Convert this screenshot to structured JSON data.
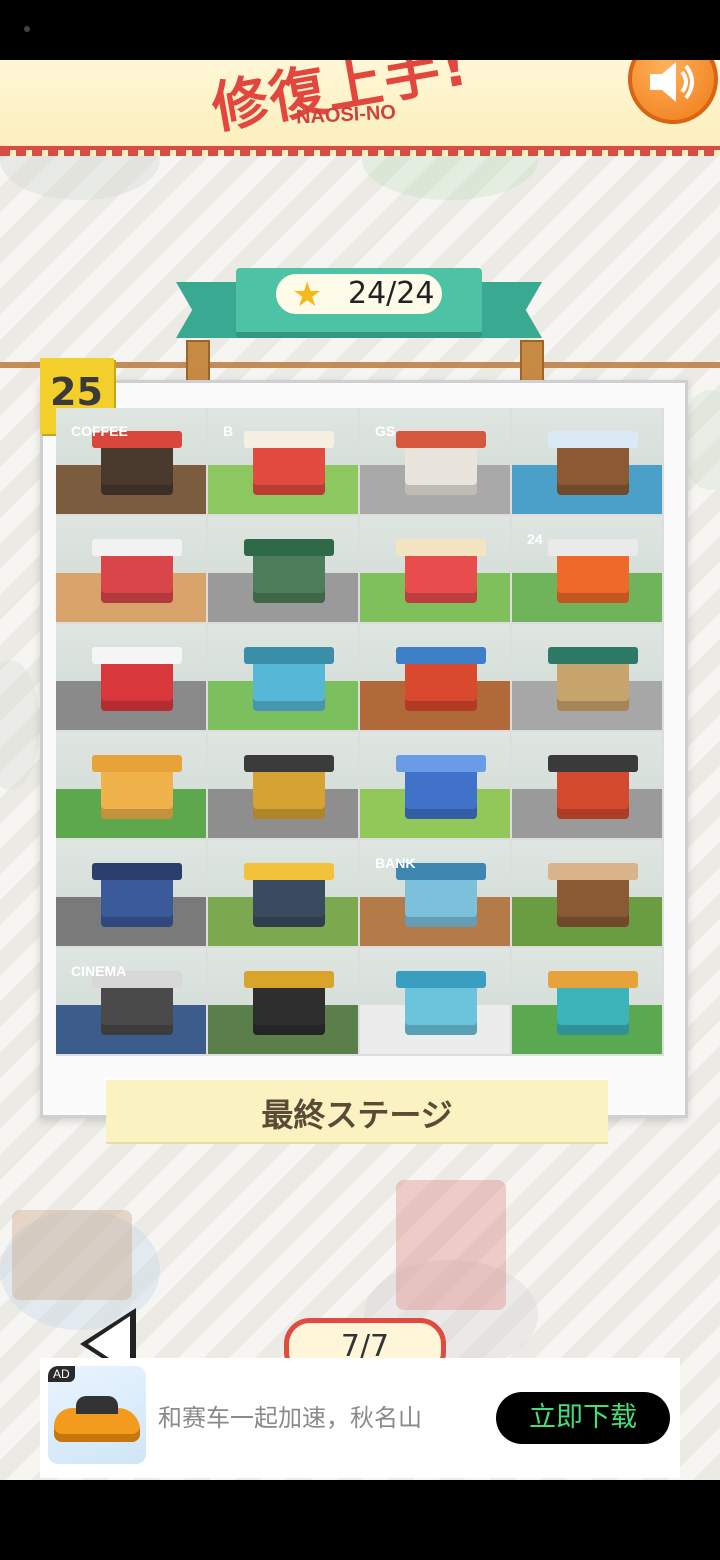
{
  "header": {
    "title_jp": "修復上手!",
    "title_en": "NAOSI-NO",
    "sound_icon": "speaker-icon"
  },
  "progress": {
    "star_icon": "star-icon",
    "stars": "24/24"
  },
  "level": {
    "number": "25",
    "stage_name": "最終ステージ"
  },
  "tiles": [
    {
      "name": "coffee-shop",
      "sign": "COFFEE",
      "ground": "#7b5c3f",
      "bld": "#4a3a2e",
      "roof": "#d9473c"
    },
    {
      "name": "burger-shop",
      "sign": "B",
      "ground": "#8cc760",
      "bld": "#e24b40",
      "roof": "#f5f0e2"
    },
    {
      "name": "gas-station",
      "sign": "GS",
      "ground": "#a9a9a9",
      "bld": "#e9e5dd",
      "roof": "#d4573e"
    },
    {
      "name": "christmas-cabin",
      "sign": "",
      "ground": "#4aa0c8",
      "bld": "#8b5a34",
      "roof": "#dbe8f5"
    },
    {
      "name": "arcade",
      "sign": "",
      "ground": "#d9a46b",
      "bld": "#d9464a",
      "roof": "#f2f2f2"
    },
    {
      "name": "flower-shop",
      "sign": "",
      "ground": "#9a9a9a",
      "bld": "#4d7d5a",
      "roof": "#2f6a48"
    },
    {
      "name": "circus",
      "sign": "",
      "ground": "#7fbf5c",
      "bld": "#e84c4c",
      "roof": "#f3e4c2"
    },
    {
      "name": "convenience-store",
      "sign": "24",
      "ground": "#6fb45a",
      "bld": "#ef6a2a",
      "roof": "#eaeaea"
    },
    {
      "name": "post-office",
      "sign": "",
      "ground": "#8a8a8a",
      "bld": "#d8373c",
      "roof": "#f5f5f5"
    },
    {
      "name": "power-station",
      "sign": "",
      "ground": "#7cbf5e",
      "bld": "#56b8d6",
      "roof": "#3a8ea8"
    },
    {
      "name": "night-market",
      "sign": "",
      "ground": "#b06a3a",
      "bld": "#d8492e",
      "roof": "#3c7fc5"
    },
    {
      "name": "ramen-stall",
      "sign": "",
      "ground": "#a7a7a7",
      "bld": "#c8a46d",
      "roof": "#2f7a67"
    },
    {
      "name": "bakery",
      "sign": "",
      "ground": "#5da84c",
      "bld": "#f0b24a",
      "roof": "#e8a23a"
    },
    {
      "name": "beer-house",
      "sign": "",
      "ground": "#8e8e8e",
      "bld": "#d6a332",
      "roof": "#3b3b3b"
    },
    {
      "name": "egg-farm",
      "sign": "",
      "ground": "#92c85a",
      "bld": "#3f72c8",
      "roof": "#6a9be6"
    },
    {
      "name": "bbq-restaurant",
      "sign": "",
      "ground": "#9a9a9a",
      "bld": "#d44a2e",
      "roof": "#3a3a3a"
    },
    {
      "name": "police-station",
      "sign": "",
      "ground": "#7a7a7a",
      "bld": "#3a5a9a",
      "roof": "#2b3f6e"
    },
    {
      "name": "bird-farm",
      "sign": "",
      "ground": "#7ca850",
      "bld": "#3a4b5f",
      "roof": "#f2c23a"
    },
    {
      "name": "bank",
      "sign": "BANK",
      "ground": "#b47a48",
      "bld": "#7cc0dc",
      "roof": "#3f86b0"
    },
    {
      "name": "sushi-bar",
      "sign": "",
      "ground": "#6a9c42",
      "bld": "#8a5a34",
      "roof": "#d9b48a"
    },
    {
      "name": "cinema",
      "sign": "CINEMA",
      "ground": "#3c5c8c",
      "bld": "#4a4a4a",
      "roof": "#d8d8d8"
    },
    {
      "name": "record-shop",
      "sign": "",
      "ground": "#5a7f4a",
      "bld": "#2e2e2e",
      "roof": "#d9a42a"
    },
    {
      "name": "aquarium",
      "sign": "",
      "ground": "#ececec",
      "bld": "#6cc4dc",
      "roof": "#3a9ec0"
    },
    {
      "name": "toy-factory",
      "sign": "",
      "ground": "#5aa850",
      "bld": "#3bb3b8",
      "roof": "#e8a23a"
    }
  ],
  "pagination": {
    "prev_icon": "triangle-left-icon",
    "page": "7/7"
  },
  "ad": {
    "tag": "AD",
    "text": "和赛车一起加速，秋名山",
    "button": "立即下载"
  }
}
